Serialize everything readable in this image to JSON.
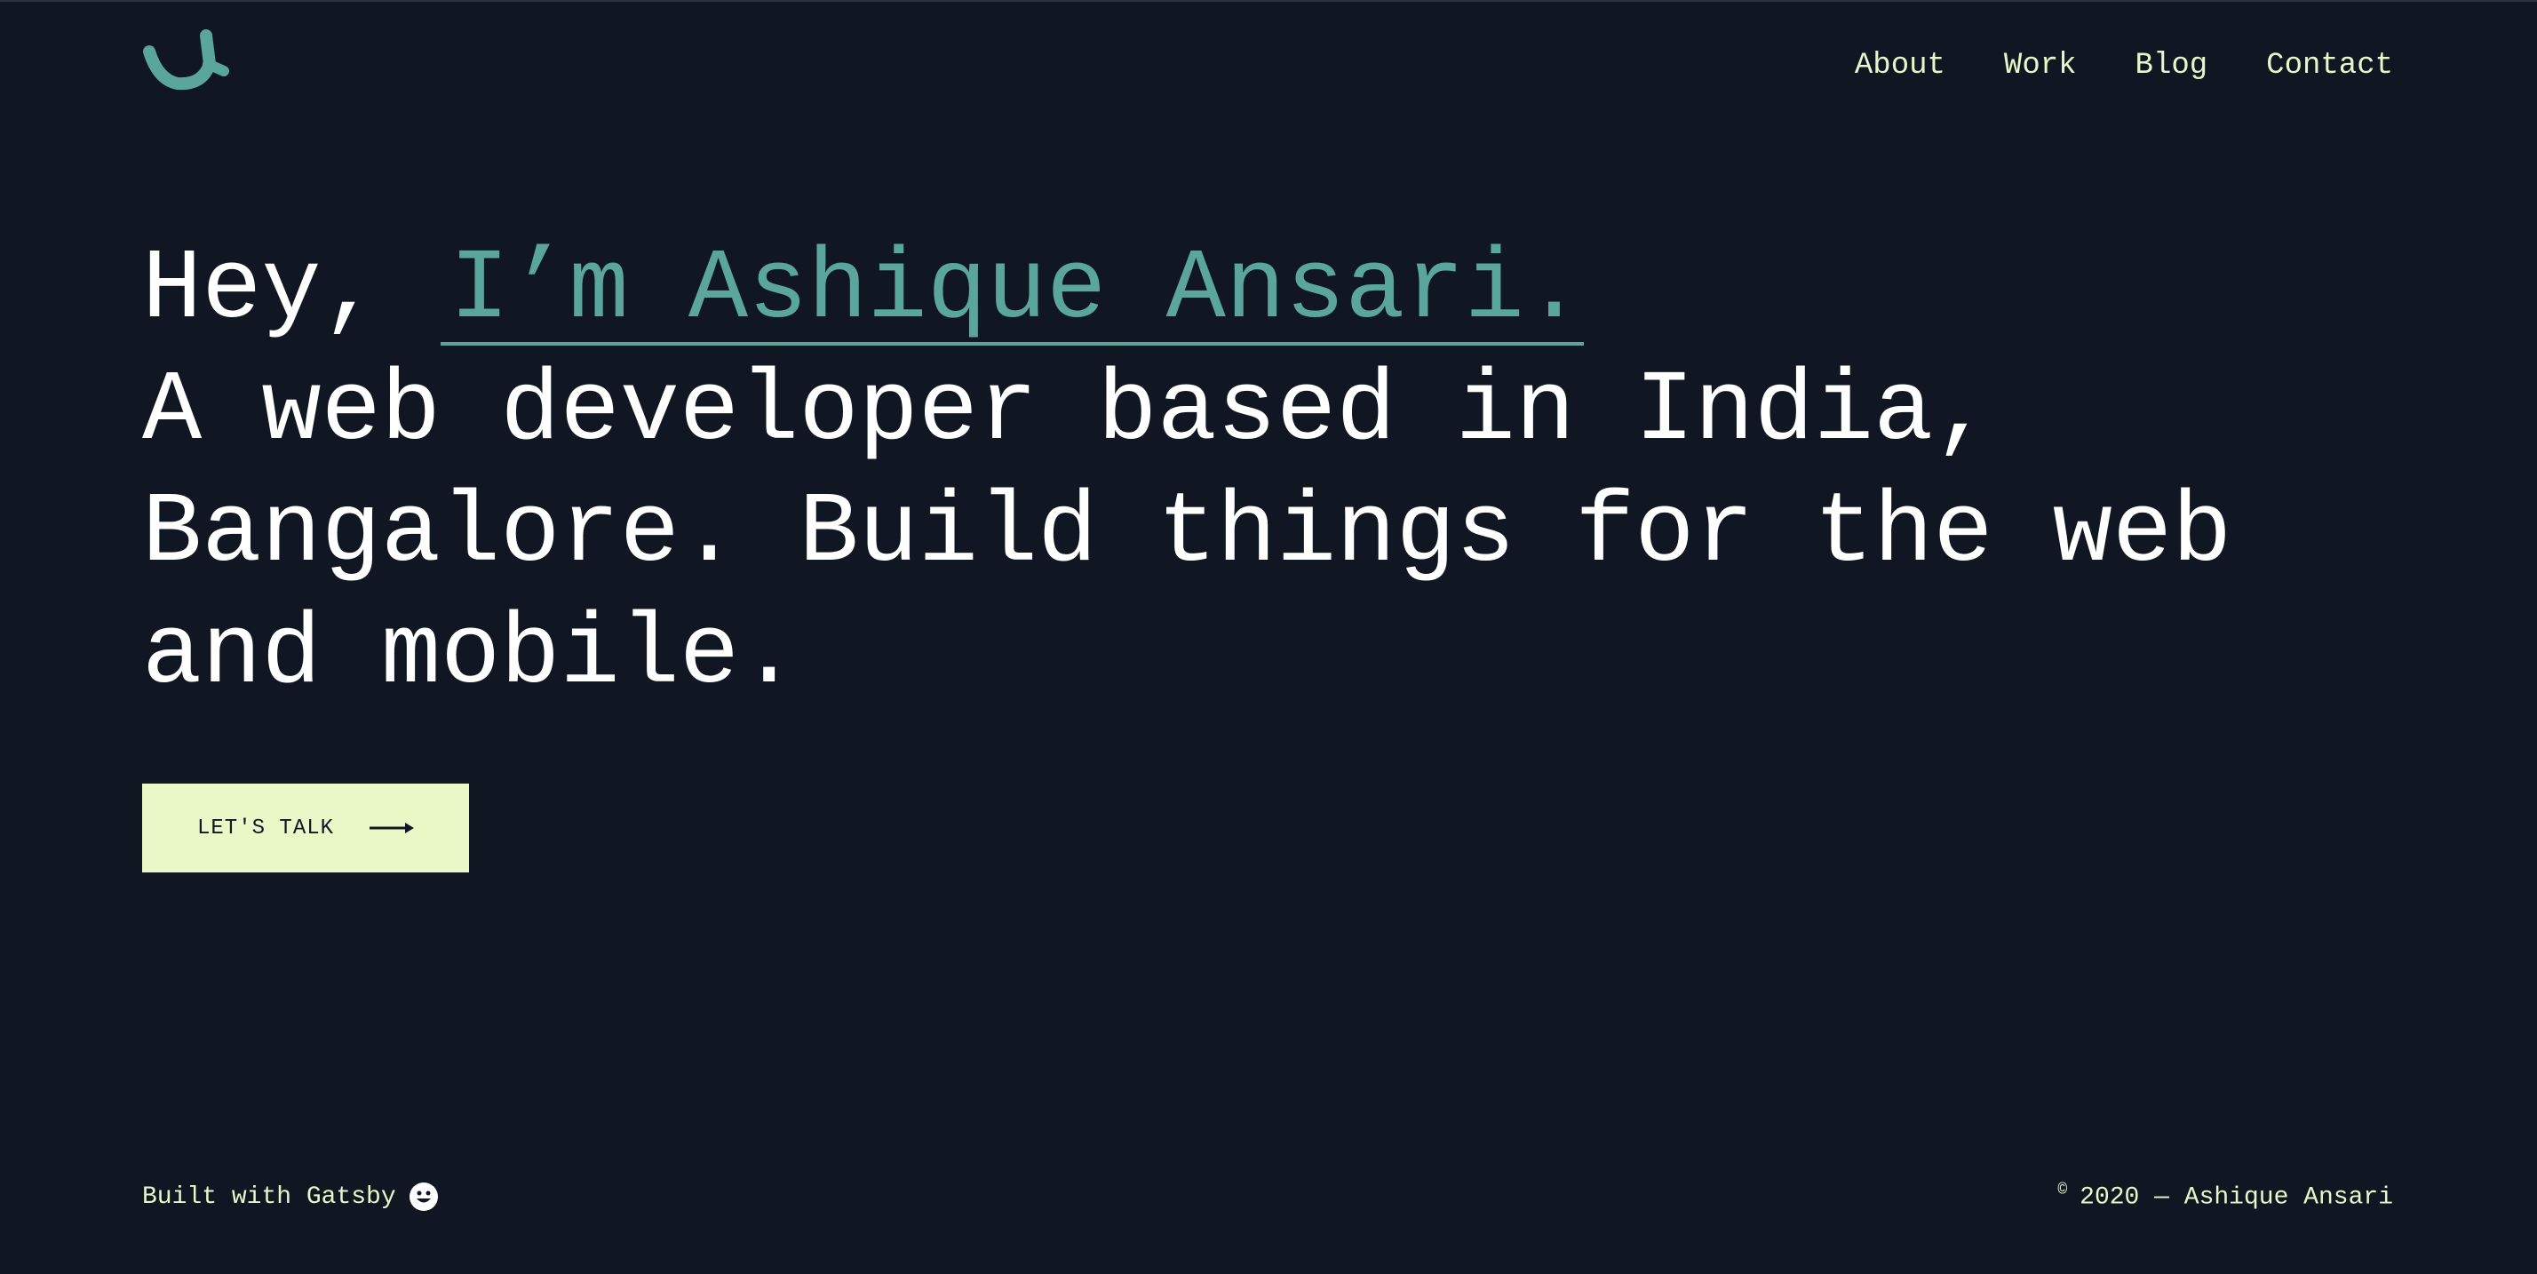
{
  "nav": {
    "items": [
      {
        "label": "About"
      },
      {
        "label": "Work"
      },
      {
        "label": "Blog"
      },
      {
        "label": "Contact"
      }
    ]
  },
  "logo": {
    "icon": "logo-u-icon",
    "color": "#5aa59c"
  },
  "hero": {
    "greeting": "Hey, ",
    "name": "I’m Ashique Ansari.",
    "line1": "A web developer based in India,",
    "line2": "Bangalore. Build things for the web",
    "line3": "and mobile."
  },
  "cta": {
    "label": "LET'S TALK",
    "icon": "arrow-right-icon"
  },
  "footer": {
    "built_with": "Built with Gatsby",
    "built_icon": "smiley-icon",
    "copyright_symbol": "©",
    "copyright_text": "2020 — Ashique Ansari"
  },
  "colors": {
    "background": "#111722",
    "accent": "#5aa59c",
    "nav_text": "#e6f7c9",
    "button_bg": "#e9f8c6"
  }
}
